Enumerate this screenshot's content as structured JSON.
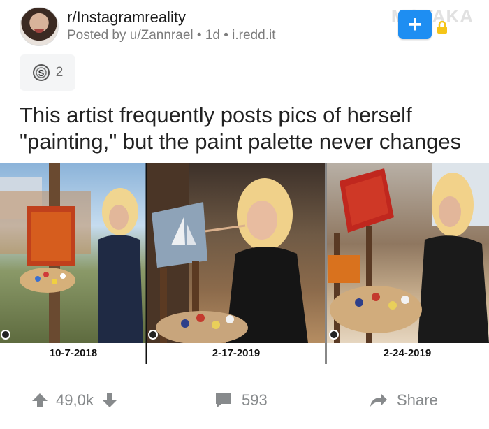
{
  "post": {
    "subreddit": "r/Instagramreality",
    "meta": "Posted by u/Zannrael • 1d • i.redd.it",
    "watermark": "MOTAKA",
    "award_count": "2",
    "title_line1": "This artist frequently posts pics of herself",
    "title_line2": "\"painting,\" but the paint palette never changes"
  },
  "gallery": {
    "dates": [
      "10-7-2018",
      "2-17-2019",
      "2-24-2019"
    ]
  },
  "footer": {
    "votes": "49,0k",
    "comments": "593",
    "share": "Share"
  },
  "colors": {
    "join_blue": "#1e8ef2",
    "lock_yellow": "#f5c518",
    "footer_gray": "#878a8c"
  }
}
